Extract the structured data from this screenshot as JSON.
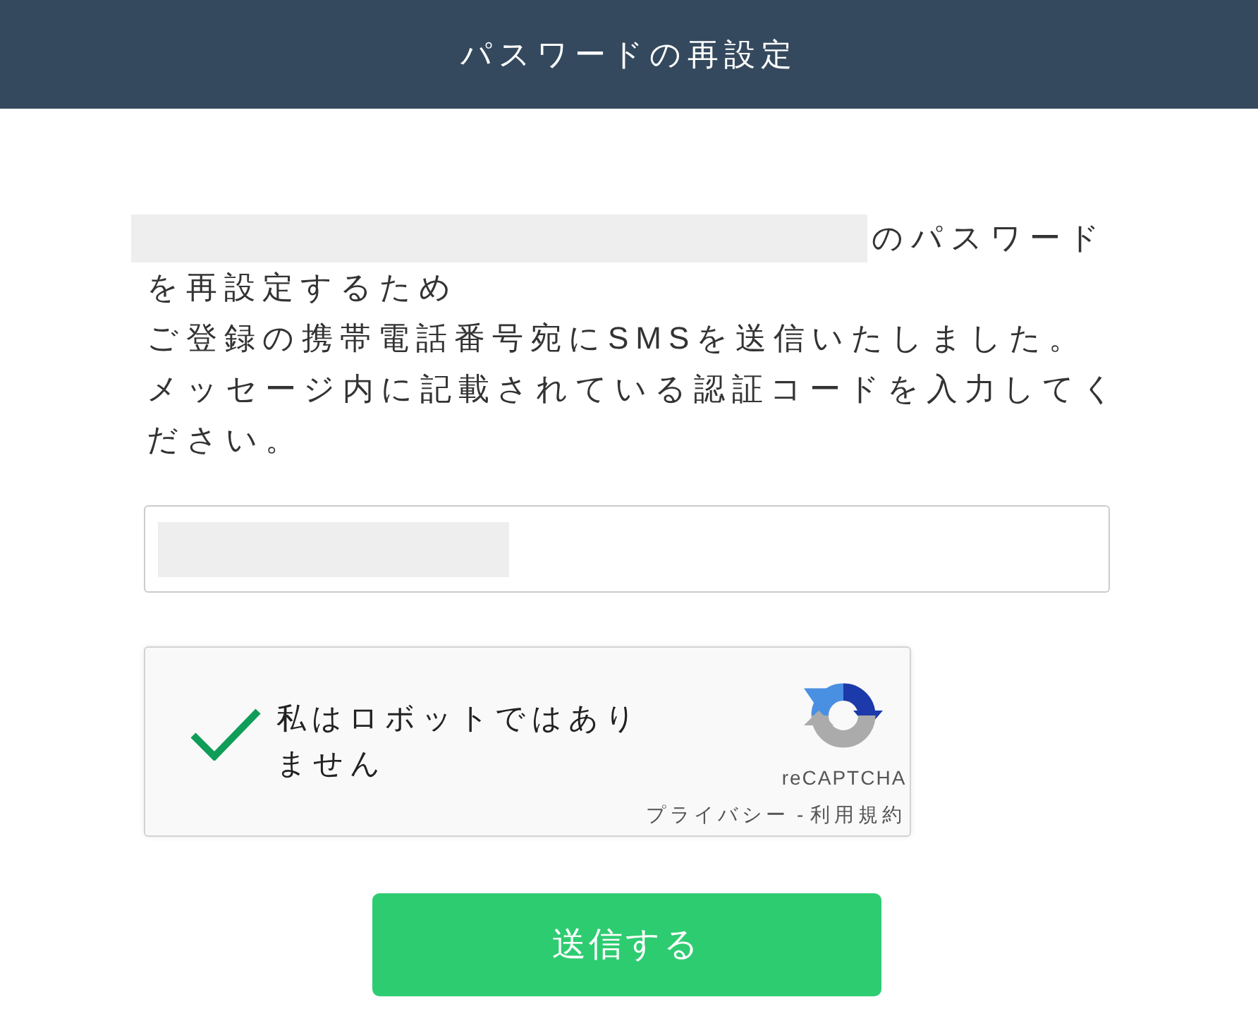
{
  "header": {
    "title": "パスワードの再設定"
  },
  "message": {
    "head": "のパスワード",
    "lines": [
      "を再設定するため",
      "ご登録の携帯電話番号宛にSMSを送信いたしました。",
      "メッセージ内に記載されている認証コードを入力してください。"
    ]
  },
  "captcha": {
    "checked": true,
    "label": "私はロボットではありません",
    "brand": "reCAPTCHA",
    "links": [
      "プライバシー",
      "利用規約"
    ],
    "separator": "-"
  },
  "submit_button": {
    "label": "送信する"
  }
}
